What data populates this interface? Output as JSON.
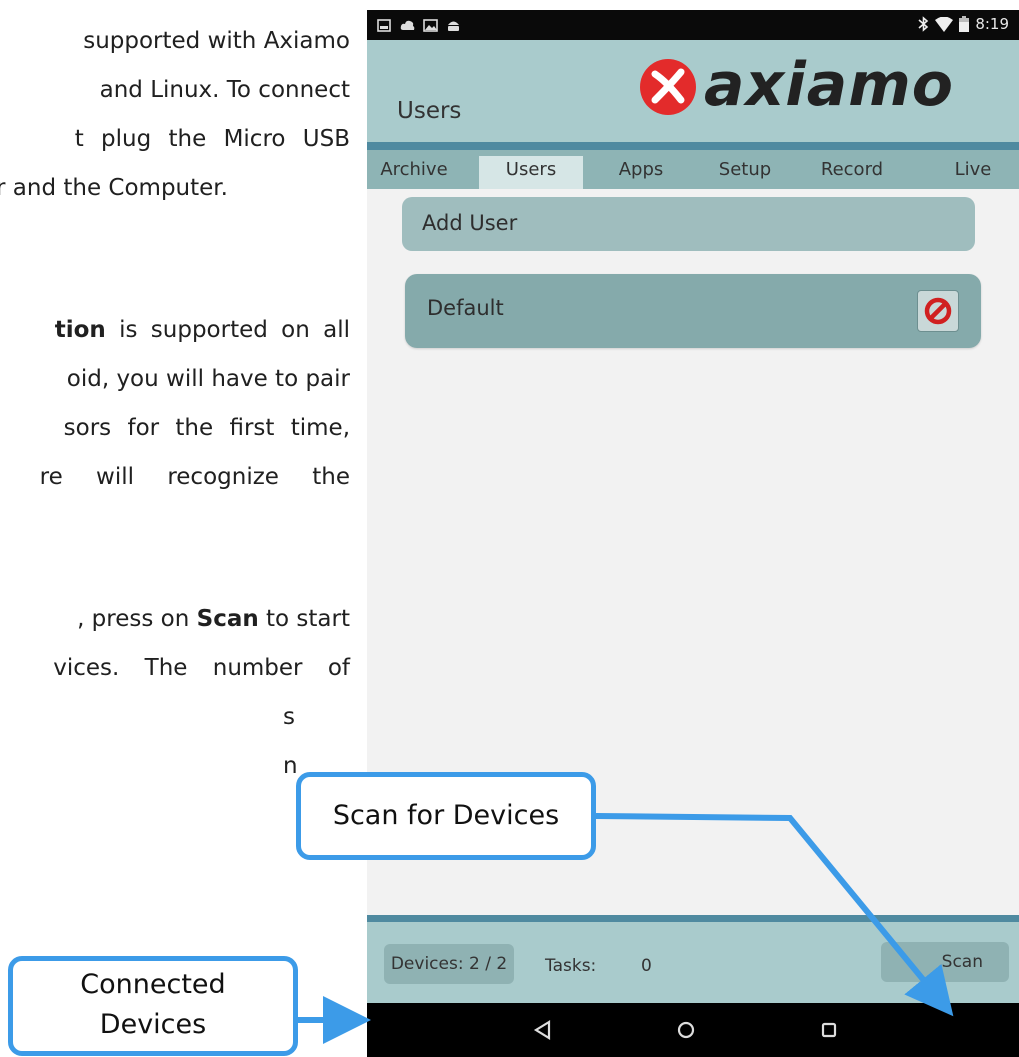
{
  "doc": {
    "lines": [
      {
        "pre": "",
        "bold": "",
        "post": "supported with Axiamo"
      },
      {
        "pre": "",
        "bold": "",
        "post": "and Linux. To connect"
      },
      {
        "pre": "",
        "bold": "",
        "post": "t plug the Micro USB"
      },
      {
        "pre": "",
        "bold": "",
        "post": "r and the Computer."
      },
      {
        "pre": "",
        "bold": "tion",
        "post": " is supported on all"
      },
      {
        "pre": "",
        "bold": "",
        "post": "oid, you will have to pair"
      },
      {
        "pre": "",
        "bold": "",
        "post": "sors for the first time,"
      },
      {
        "pre": "",
        "bold": "",
        "post": "re will recognize the"
      },
      {
        "pre": ", press on ",
        "bold": "Scan",
        "post": " to start"
      },
      {
        "pre": "",
        "bold": "",
        "post": "vices. The number of"
      },
      {
        "pre": "",
        "bold": "",
        "post": "s"
      },
      {
        "pre": "",
        "bold": "",
        "post": "n"
      }
    ]
  },
  "phone": {
    "status_bar": {
      "time": "8:19",
      "left_icons": [
        "notification-icon",
        "cloud-icon",
        "image-icon",
        "android-icon"
      ],
      "right_icons": [
        "bluetooth-icon",
        "wifi-icon",
        "battery-icon"
      ]
    },
    "app_bar": {
      "title": "Users",
      "logo_text": "axiamo"
    },
    "tabs": [
      {
        "label": "Archive",
        "active": false
      },
      {
        "label": "Users",
        "active": true
      },
      {
        "label": "Apps",
        "active": false
      },
      {
        "label": "Setup",
        "active": false
      },
      {
        "label": "Record",
        "active": false
      },
      {
        "label": "Live",
        "active": false
      }
    ],
    "add_user_label": "Add User",
    "users": [
      {
        "name": "Default"
      }
    ],
    "bottom_bar": {
      "devices_label": "Devices: 2 / 2",
      "tasks_label": "Tasks:",
      "tasks_value": "0",
      "scan_label": "Scan"
    },
    "nav": [
      "back-icon",
      "home-icon",
      "recents-icon"
    ]
  },
  "callouts": {
    "scan": "Scan for Devices",
    "devices_line1": "Connected",
    "devices_line2": "Devices"
  },
  "colors": {
    "accent": "#3c9be8",
    "app_bar": "#a9cbcc",
    "tab_underline": "#4f8aa0",
    "logo_red": "#e32b2b"
  }
}
